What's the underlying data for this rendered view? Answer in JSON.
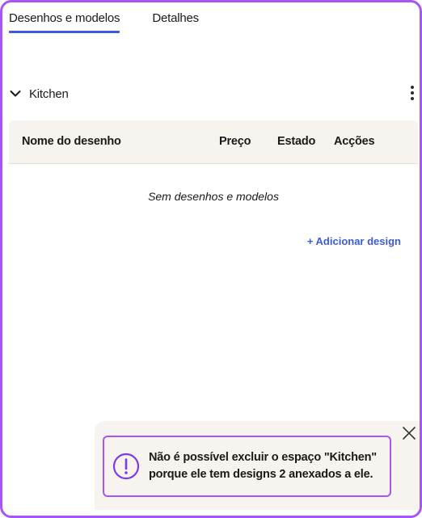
{
  "tabs": [
    {
      "label": "Desenhos e modelos",
      "active": true
    },
    {
      "label": "Detalhes",
      "active": false
    }
  ],
  "section": {
    "title": "Kitchen",
    "expand_icon": "chevron-down-icon",
    "menu_icon": "kebab-menu-icon"
  },
  "table": {
    "columns": [
      "Nome do desenho",
      "Preço",
      "Estado",
      "Acções"
    ],
    "rows": [],
    "empty_message": "Sem desenhos e modelos"
  },
  "actions": {
    "add_design_label": "+ Adicionar design"
  },
  "toast": {
    "line1": "Não é possível excluir o espaço \"Kitchen\"",
    "line2": "porque ele tem designs 2 anexados a ele.",
    "icon": "alert-icon",
    "close_icon": "close-icon"
  },
  "colors": {
    "frame_border": "#a855f7",
    "accent": "#3b5bdb",
    "header_bg": "#f7f3ef",
    "alert": "#7c3aed"
  }
}
